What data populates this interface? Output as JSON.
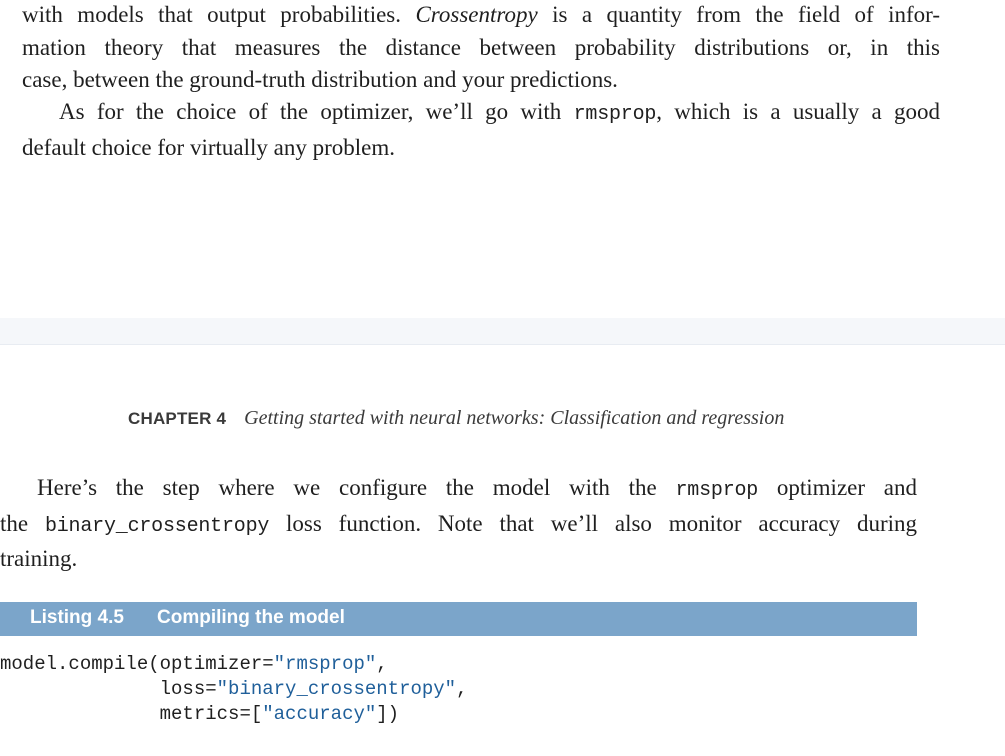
{
  "page_top": {
    "paragraph_1": {
      "line_1": "with models that output probabilities.",
      "line_1_term": "Crossentropy",
      "line_1_tail": "is a quantity from the field of infor-",
      "line_2": "mation theory that measures the distance between probability distributions or, in this",
      "line_3": "case, between the ground-truth distribution and your predictions."
    },
    "paragraph_2": {
      "line_1_a": "As for the choice of the optimizer, we’ll go with",
      "line_1_code": "rmsprop",
      "line_1_b": ", which is a usually a good",
      "line_2": "default choice for virtually any problem."
    }
  },
  "page_bottom": {
    "chapter_label": "CHAPTER 4",
    "chapter_title": "Getting started with neural networks: Classification and regression",
    "paragraph": {
      "line_1_a": "Here’s the step where we configure the model with the",
      "line_1_code": "rmsprop",
      "line_1_b": "optimizer and",
      "line_2_a": "the",
      "line_2_code": "binary_crossentropy",
      "line_2_b": "loss function. Note that we’ll also monitor accuracy during",
      "line_3": "training."
    },
    "listing": {
      "label": "Listing 4.5",
      "title": "Compiling the model",
      "code": {
        "line_1_a": "model.compile(optimizer=",
        "line_1_str": "\"rmsprop\"",
        "line_1_b": ",",
        "line_2_a": "              loss=",
        "line_2_str": "\"binary_crossentropy\"",
        "line_2_b": ",",
        "line_3_a": "              metrics=[",
        "line_3_str": "\"accuracy\"",
        "line_3_b": "])"
      }
    }
  },
  "colors": {
    "text": "#1f1f1f",
    "listing_bar": "#7ba5ca",
    "listing_bar_text": "#ffffff",
    "page_gap": "#f5f7fa"
  }
}
